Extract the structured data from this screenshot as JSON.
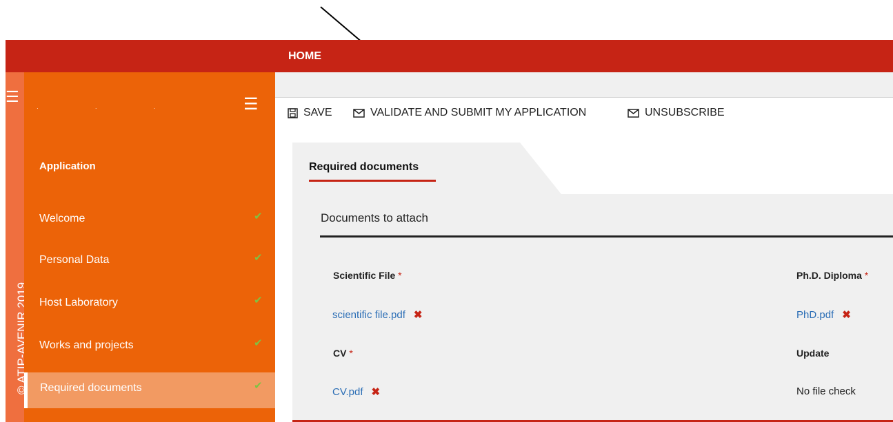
{
  "header": {
    "home_label": "HOME"
  },
  "left_strip": {
    "vertical_text": "ATIP-AVENIR 2019"
  },
  "sidebar": {
    "section_title": "Application",
    "items": [
      {
        "label": "Welcome",
        "done": true
      },
      {
        "label": "Personal Data",
        "done": true
      },
      {
        "label": "Host Laboratory",
        "done": true
      },
      {
        "label": "Works and projects",
        "done": true
      },
      {
        "label": "Required documents",
        "done": true,
        "active": true
      }
    ]
  },
  "toolbar": {
    "save_label": "SAVE",
    "validate_label": "VALIDATE AND SUBMIT MY APPLICATION",
    "unsubscribe_label": "UNSUBSCRIBE"
  },
  "tab": {
    "label": "Required documents"
  },
  "documents": {
    "section_title": "Documents to attach",
    "scientific_file": {
      "label": "Scientific File",
      "required_mark": "*",
      "file": "scientific file.pdf"
    },
    "phd_diploma": {
      "label": "Ph.D. Diploma",
      "required_mark": "*",
      "file": "PhD.pdf"
    },
    "cv": {
      "label": "CV",
      "required_mark": "*",
      "file": "CV.pdf"
    },
    "update": {
      "label": "Update",
      "value": "No file check"
    },
    "delete_glyph": "✖"
  },
  "colors": {
    "header_red": "#c62415",
    "sidebar_orange": "#ec6308",
    "active_item": "#f29a62",
    "check_green": "#7fc243",
    "link_blue": "#2a6db5"
  }
}
